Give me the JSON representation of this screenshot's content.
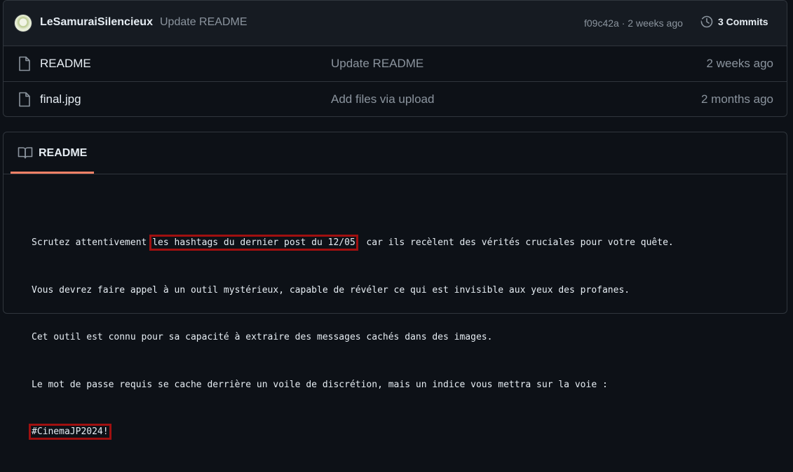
{
  "latest_commit": {
    "author": "LeSamuraiSilencieux",
    "message": "Update README",
    "hash": "f09c42a",
    "separator": " · ",
    "time": "2 weeks ago",
    "commits_label": "3 Commits"
  },
  "files": [
    {
      "icon": "file-icon",
      "name": "README",
      "message": "Update README",
      "date": "2 weeks ago"
    },
    {
      "icon": "file-icon",
      "name": "final.jpg",
      "message": "Add files via upload",
      "date": "2 months ago"
    }
  ],
  "readme": {
    "tab_label": "README",
    "line1_pre": "Scrutez attentivement ",
    "line1_highlight": "les hashtags du dernier post du 12/05",
    "line1_post": "  car ils recèlent des vérités cruciales pour votre quête.",
    "line2": "Vous devrez faire appel à un outil mystérieux, capable de révéler ce qui est invisible aux yeux des profanes.",
    "line3": "Cet outil est connu pour sa capacité à extraire des messages cachés dans des images.",
    "line4": "Le mot de passe requis se cache derrière un voile de discrétion, mais un indice vous mettra sur la voie :",
    "line5_highlight": "#CinemaJP2024!"
  },
  "colors": {
    "background": "#0d1117",
    "border": "#30363d",
    "muted_text": "#8b949e",
    "tab_underline": "#f78166",
    "highlight_box": "#a01010"
  }
}
